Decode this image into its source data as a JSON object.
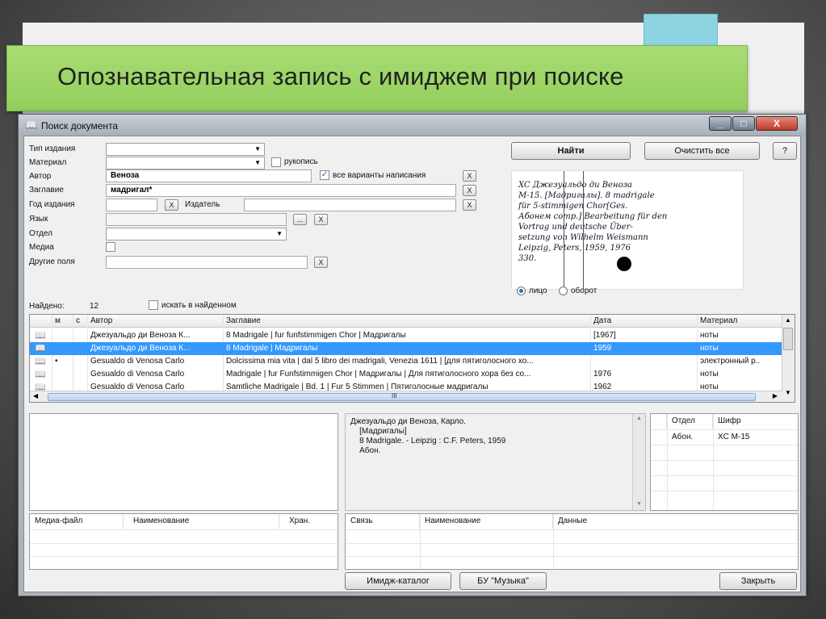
{
  "slide": {
    "title": "Опознавательная запись с имиджем  при поиске"
  },
  "window": {
    "title": "Поиск документа",
    "icon": "book-icon",
    "controls": {
      "minimize": "_",
      "maximize": "□",
      "close": "X"
    }
  },
  "form": {
    "labels": {
      "type": "Тип издания",
      "material": "Материал",
      "author": "Автор",
      "title": "Заглавие",
      "year": "Год издания",
      "publisher": "Издатель",
      "language": "Язык",
      "department": "Отдел",
      "media": "Медиа",
      "other": "Другие поля"
    },
    "author_value": "Веноза",
    "title_value": "мадригал*",
    "manuscript_label": "рукопись",
    "all_variants_label": "все варианты написания",
    "ellipsis": "...",
    "x": "X"
  },
  "buttons": {
    "find": "Найти",
    "clear": "Очистить все",
    "help": "?",
    "image_catalog": "Имидж-каталог",
    "bu_music": "БУ \"Музыка\"",
    "close": "Закрыть"
  },
  "card": {
    "lines": [
      "XC        Джезуальдо ди Веноза",
      "M-15.    [Мадригалы]. 8 madrigale",
      "           für 5-stimmigen Chor[Ges.",
      "Абонем  comp.] Bearbeitung für den",
      "           Vortrag und deutsche Über-",
      "           setzung von Wilhelm Weismann",
      "           Leipzig, Peters, 1959, 1976",
      "           330."
    ],
    "side_face": "лицо",
    "side_back": "оборот"
  },
  "results": {
    "found_label": "Найдено:",
    "found_count": "12",
    "search_in_found": "искать в найденном",
    "columns": [
      "м",
      "с",
      "Автор",
      "Заглавие",
      "Дата",
      "Материал"
    ],
    "rows": [
      {
        "icon": "book-icon",
        "m": "",
        "author": "Джезуальдо ди Веноза К...",
        "title": "8 Madrigale | fur funfstimmigen Chor | Мадригалы",
        "date": "[1967]",
        "material": "ноты"
      },
      {
        "icon": "book-icon",
        "m": "",
        "author": "Джезуальдо ди Веноза К...",
        "title": "8 Madrigale | Мадригалы",
        "date": "1959",
        "material": "ноты"
      },
      {
        "icon": "book-icon",
        "m": "•",
        "author": "Gesualdo di Venosa Carlo",
        "title": "Dolcissima mia vita | dal 5 libro dei madrigali, Venezia 1611 | [для пятиголосного хо...",
        "date": "",
        "material": "электронный р.."
      },
      {
        "icon": "book-icon",
        "m": "",
        "author": "Gesualdo di Venosa Carlo",
        "title": "Madrigale | fur Funfstimmigen Chor | Мадригалы | Для пятиголосного хора без со...",
        "date": "1976",
        "material": "ноты"
      },
      {
        "icon": "book-icon",
        "m": "",
        "author": "Gesualdo di Venosa Carlo",
        "title": "Samtliche Madrigale | Bd. 1 | Fur 5 Stimmen | Пятиголосные мадригалы",
        "date": "1962",
        "material": "ноты"
      }
    ],
    "scroll_mark": "III"
  },
  "detail": {
    "lines": [
      "Джезуальдо ди Веноза, Карло.",
      "    [Мадригалы]",
      "    8 Madrigale. - Leipzig : C.F. Peters, 1959",
      "    Абон."
    ]
  },
  "holdings": {
    "columns": [
      "Отдел",
      "Шифр"
    ],
    "rows": [
      {
        "dept": "Абон.",
        "code": "XC M-15"
      }
    ]
  },
  "media_table": {
    "columns": [
      "Медиа-файл",
      "Наименование",
      "Хран."
    ]
  },
  "links_table": {
    "columns": [
      "Связь",
      "Наименование",
      "Данные"
    ]
  }
}
